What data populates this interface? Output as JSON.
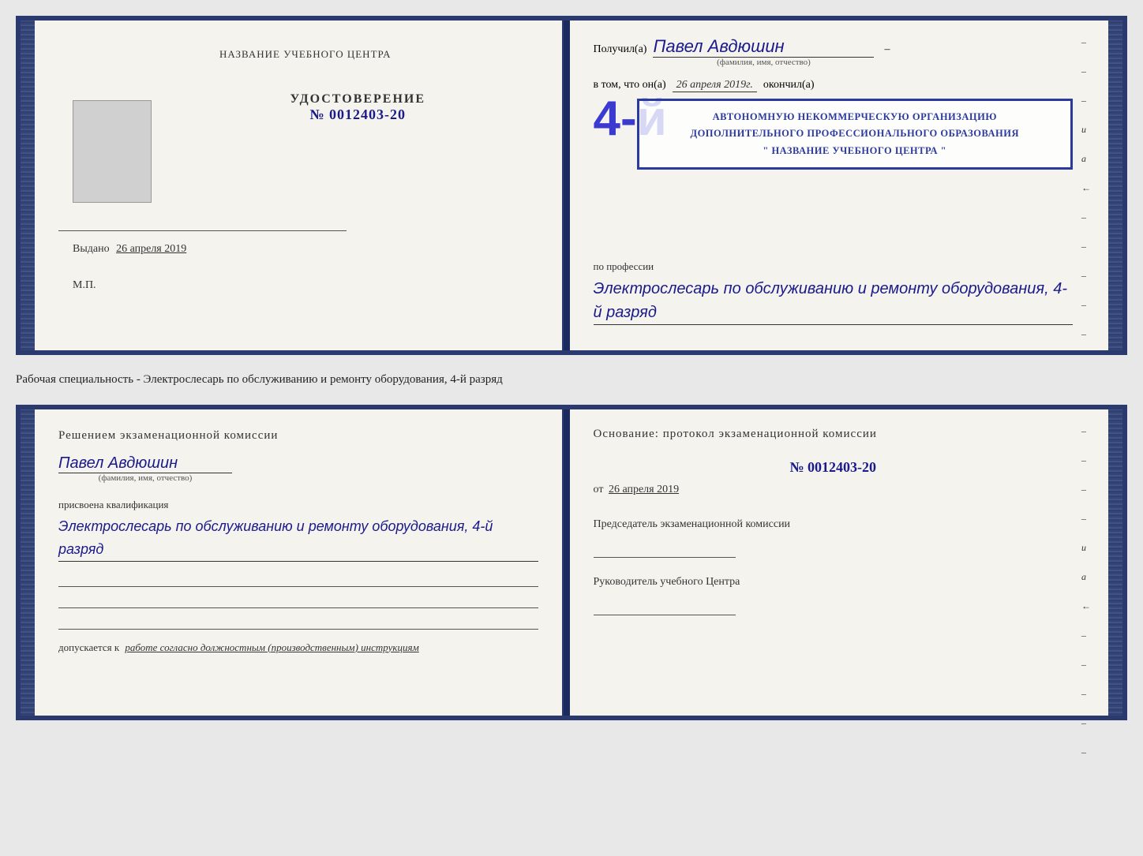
{
  "top_document": {
    "left_page": {
      "title": "НАЗВАНИЕ УЧЕБНОГО ЦЕНТРА",
      "cert_label": "УДОСТОВЕРЕНИЕ",
      "cert_number": "№ 0012403-20",
      "issued_label": "Выдано",
      "issued_date": "26 апреля 2019",
      "mp_label": "М.П."
    },
    "right_page": {
      "received_prefix": "Получил(а)",
      "received_name": "Павел Авдюшин",
      "name_hint": "(фамилия, имя, отчество)",
      "in_that_prefix": "в том, что он(а)",
      "date_value": "26 апреля 2019г.",
      "finished_label": "окончил(а)",
      "stamp_line1": "АВТОНОМНУЮ НЕКОММЕРЧЕСКУЮ ОРГАНИЗАЦИЮ",
      "stamp_line2": "ДОПОЛНИТЕЛЬНОГО ПРОФЕССИОНАЛЬНОГО ОБРАЗОВАНИЯ",
      "stamp_line3": "\" НАЗВАНИЕ УЧЕБНОГО ЦЕНТРА \"",
      "big_number": "4-й",
      "profession_label": "по профессии",
      "profession_value": "Электрослесарь по обслуживанию и ремонту оборудования, 4-й разряд",
      "edge_marks": [
        "-",
        "-",
        "-",
        "-",
        "и",
        "а",
        "←",
        "-",
        "-",
        "-",
        "-",
        "-"
      ]
    }
  },
  "between_label": "Рабочая специальность - Электрослесарь по обслуживанию и ремонту оборудования, 4-й разряд",
  "bottom_document": {
    "left_page": {
      "decision_text": "Решением экзаменационной комиссии",
      "person_name": "Павел Авдюшин",
      "name_hint": "(фамилия, имя, отчество)",
      "assigned_label": "присвоена квалификация",
      "qualification_value": "Электрослесарь по обслуживанию и ремонту оборудования, 4-й разряд",
      "allowed_prefix": "допускается к",
      "allowed_value": "работе согласно должностным (производственным) инструкциям"
    },
    "right_page": {
      "basis_label": "Основание: протокол экзаменационной комиссии",
      "protocol_number": "№ 0012403-20",
      "from_prefix": "от",
      "from_date": "26 апреля 2019",
      "chairman_label": "Председатель экзаменационной комиссии",
      "head_label": "Руководитель учебного Центра",
      "edge_marks": [
        "-",
        "-",
        "-",
        "-",
        "и",
        "а",
        "←",
        "-",
        "-",
        "-",
        "-",
        "-"
      ]
    }
  }
}
